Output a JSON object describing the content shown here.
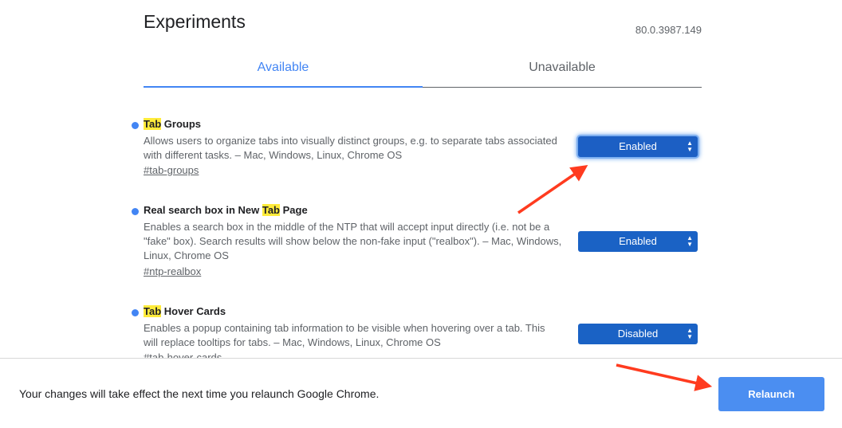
{
  "page": {
    "title": "Experiments",
    "version": "80.0.3987.149"
  },
  "tabs": [
    {
      "label": "Available"
    },
    {
      "label": "Unavailable"
    }
  ],
  "experiments": [
    {
      "name_highlight": "Tab",
      "name_rest": " Groups",
      "description": "Allows users to organize tabs into visually distinct groups, e.g. to separate tabs associated with different tasks. – Mac, Windows, Linux, Chrome OS",
      "link": "#tab-groups",
      "selected": "Enabled"
    },
    {
      "name_prefix": "Real search box in New ",
      "name_highlight": "Tab",
      "name_rest": " Page",
      "description": "Enables a search box in the middle of the NTP that will accept input directly (i.e. not be a \"fake\" box). Search results will show below the non-fake input (\"realbox\"). – Mac, Windows, Linux, Chrome OS",
      "link": "#ntp-realbox",
      "selected": "Enabled"
    },
    {
      "name_highlight": "Tab",
      "name_rest": " Hover Cards",
      "description": "Enables a popup containing tab information to be visible when hovering over a tab. This will replace tooltips for tabs. – Mac, Windows, Linux, Chrome OS",
      "link": "#tab-hover-cards",
      "selected": "Disabled"
    }
  ],
  "footer": {
    "message": "Your changes will take effect the next time you relaunch Google Chrome.",
    "relaunch_label": "Relaunch"
  },
  "colors": {
    "accent": "#4285f4",
    "select_bg": "#1a62c5",
    "highlight": "#ffeb3b",
    "annotation_arrow": "#ff3b1f"
  },
  "icons": {
    "select_arrows": "chevron-up-down-icon",
    "experiment_marker": "bullet-dot-icon"
  }
}
